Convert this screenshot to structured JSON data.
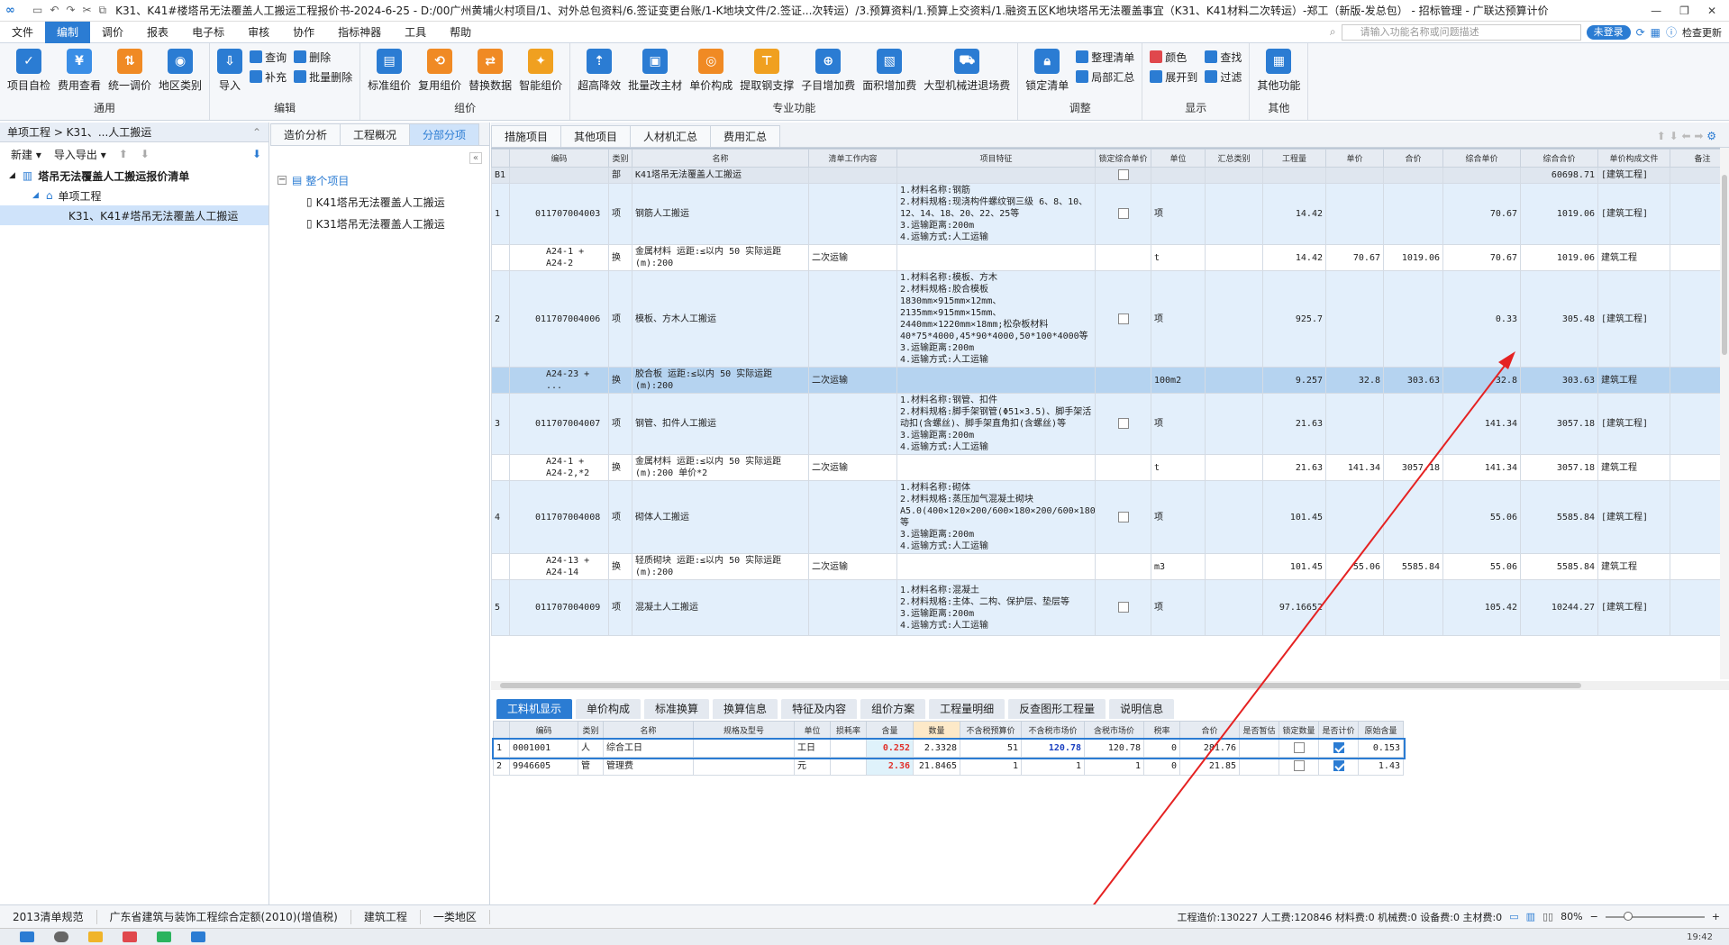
{
  "title": "K31、K41#楼塔吊无法覆盖人工搬运工程报价书-2024-6-25 - D:/00广州黄埔火村项目/1、对外总包资料/6.签证变更台账/1-K地块文件/2.签证...次转运）/3.预算资料/1.预算上交资料/1.融资五区K地块塔吊无法覆盖事宜（K31、K41材料二次转运）-郑工（新版-发总包） - 招标管理 - 广联达预算计价",
  "menu": [
    "文件",
    "编制",
    "调价",
    "报表",
    "电子标",
    "审核",
    "协作",
    "指标神器",
    "工具",
    "帮助"
  ],
  "menu_active": "编制",
  "search_placeholder": "请输入功能名称或问题描述",
  "login": "未登录",
  "check_update": "检查更新",
  "ribbon": {
    "g1": {
      "name": "通用",
      "b": [
        "项目自检",
        "费用查看",
        "统一调价",
        "地区类别"
      ]
    },
    "g2": {
      "name": "编辑",
      "b": [
        "导入",
        "查询",
        "补充",
        "删除",
        "批量删除"
      ]
    },
    "g3": {
      "name": "组价",
      "b": [
        "标准组价",
        "复用组价",
        "替换数据",
        "智能组价"
      ]
    },
    "g4": {
      "name": "专业功能",
      "b": [
        "超高降效",
        "批量改主材",
        "单价构成",
        "提取钢支撑",
        "子目增加费",
        "面积增加费",
        "大型机械进退场费"
      ]
    },
    "g5": {
      "name": "调整",
      "b": [
        "锁定清单",
        "整理清单",
        "局部汇总"
      ]
    },
    "g6": {
      "name": "显示",
      "b": [
        "颜色",
        "查找",
        "展开到",
        "过滤"
      ]
    },
    "g7": {
      "name": "其他",
      "b": [
        "其他功能"
      ]
    }
  },
  "left": {
    "breadcrumb": "单项工程 > K31、...人工搬运",
    "new": "新建",
    "import_export": "导入导出",
    "tree": [
      "塔吊无法覆盖人工搬运报价清单",
      "单项工程",
      "K31、K41#塔吊无法覆盖人工搬运"
    ]
  },
  "mid": {
    "tabs": [
      "造价分析",
      "工程概况",
      "分部分项"
    ],
    "tree": [
      "整个项目",
      "K41塔吊无法覆盖人工搬运",
      "K31塔吊无法覆盖人工搬运"
    ]
  },
  "main_tabs": [
    "措施项目",
    "其他项目",
    "人材机汇总",
    "费用汇总"
  ],
  "grid_headers": [
    "",
    "编码",
    "类别",
    "名称",
    "清单工作内容",
    "项目特征",
    "锁定综合单价",
    "单位",
    "汇总类别",
    "工程量",
    "单价",
    "合价",
    "综合单价",
    "综合合价",
    "单价构成文件",
    "备注"
  ],
  "rows": [
    {
      "t": "sec",
      "c": [
        "B1",
        "",
        "部",
        "K41塔吊无法覆盖人工搬运",
        "",
        "",
        "",
        "",
        "",
        "",
        "",
        "",
        "",
        "60698.71",
        "[建筑工程]",
        ""
      ]
    },
    {
      "t": "q",
      "c": [
        "1",
        "011707004003",
        "项",
        "钢筋人工搬运",
        "",
        "1.材料名称:钢筋\n2.材料规格:现浇构件螺纹钢三级 6、8、10、12、14、18、20、22、25等\n3.运输距离:200m\n4.运输方式:人工运输",
        "",
        "项",
        "",
        "14.42",
        "",
        "",
        "70.67",
        "1019.06",
        "[建筑工程]",
        ""
      ]
    },
    {
      "t": "d",
      "c": [
        "",
        "A24-1 + A24-2",
        "换",
        "金属材料 运距:≤以内 50 实际运距(m):200",
        "二次运输",
        "",
        "",
        "t",
        "",
        "14.42",
        "70.67",
        "1019.06",
        "70.67",
        "1019.06",
        "建筑工程",
        ""
      ]
    },
    {
      "t": "q",
      "c": [
        "2",
        "011707004006",
        "项",
        "模板、方木人工搬运",
        "",
        "1.材料名称:模板、方木\n2.材料规格:胶合模板 1830mm×915mm×12mm、2135mm×915mm×15mm、2440mm×1220mm×18mm;松杂板材料 40*75*4000,45*90*4000,50*100*4000等\n3.运输距离:200m\n4.运输方式:人工运输",
        "",
        "项",
        "",
        "925.7",
        "",
        "",
        "0.33",
        "305.48",
        "[建筑工程]",
        ""
      ]
    },
    {
      "t": "sel",
      "c": [
        "",
        "A24-23 + ...",
        "换",
        "胶合板 运距:≤以内 50 实际运距(m):200",
        "二次运输",
        "",
        "",
        "100m2",
        "",
        "9.257",
        "32.8",
        "303.63",
        "32.8",
        "303.63",
        "建筑工程",
        ""
      ]
    },
    {
      "t": "q",
      "c": [
        "3",
        "011707004007",
        "项",
        "钢管、扣件人工搬运",
        "",
        "1.材料名称:钢管、扣件\n2.材料规格:脚手架钢管(Φ51×3.5)、脚手架活动扣(含螺丝)、脚手架直角扣(含螺丝)等\n3.运输距离:200m\n4.运输方式:人工运输",
        "",
        "项",
        "",
        "21.63",
        "",
        "",
        "141.34",
        "3057.18",
        "[建筑工程]",
        ""
      ]
    },
    {
      "t": "d",
      "c": [
        "",
        "A24-1 + A24-2,*2",
        "换",
        "金属材料 运距:≤以内 50 实际运距(m):200 单价*2",
        "二次运输",
        "",
        "",
        "t",
        "",
        "21.63",
        "141.34",
        "3057.18",
        "141.34",
        "3057.18",
        "建筑工程",
        ""
      ]
    },
    {
      "t": "q",
      "c": [
        "4",
        "011707004008",
        "项",
        "砌体人工搬运",
        "",
        "1.材料名称:砌体\n2.材料规格:蒸压加气混凝土砌块A5.0(400×120×200/600×180×200/600×180×200)等\n3.运输距离:200m\n4.运输方式:人工运输",
        "",
        "项",
        "",
        "101.45",
        "",
        "",
        "55.06",
        "5585.84",
        "[建筑工程]",
        ""
      ]
    },
    {
      "t": "d",
      "c": [
        "",
        "A24-13 + A24-14",
        "换",
        "轻质砌块 运距:≤以内 50 实际运距(m):200",
        "二次运输",
        "",
        "",
        "m3",
        "",
        "101.45",
        "55.06",
        "5585.84",
        "55.06",
        "5585.84",
        "建筑工程",
        ""
      ]
    },
    {
      "t": "q",
      "c": [
        "5",
        "011707004009",
        "项",
        "混凝土人工搬运",
        "",
        "1.材料名称:混凝土\n2.材料规格:主体、二构、保护层、垫层等\n3.运输距离:200m\n4.运输方式:人工运输",
        "",
        "项",
        "",
        "97.16652",
        "",
        "",
        "105.42",
        "10244.27",
        "[建筑工程]",
        ""
      ]
    }
  ],
  "bottom_tabs": [
    "工料机显示",
    "单价构成",
    "标准换算",
    "换算信息",
    "特征及内容",
    "组价方案",
    "工程量明细",
    "反查图形工程量",
    "说明信息"
  ],
  "bottom_headers": [
    "",
    "编码",
    "类别",
    "名称",
    "规格及型号",
    "单位",
    "损耗率",
    "含量",
    "数量",
    "不含税预算价",
    "不含税市场价",
    "含税市场价",
    "税率",
    "合价",
    "是否暂估",
    "锁定数量",
    "是否计价",
    "原始含量"
  ],
  "bottom_rows": [
    {
      "c": [
        "1",
        "0001001",
        "人",
        "综合工日",
        "",
        "工日",
        "",
        "0.252",
        "2.3328",
        "51",
        "120.78",
        "120.78",
        "0",
        "281.76",
        "",
        "",
        "on",
        "0.153"
      ]
    },
    {
      "c": [
        "2",
        "9946605",
        "管",
        "管理费",
        "",
        "元",
        "",
        "2.36",
        "21.8465",
        "1",
        "1",
        "1",
        "0",
        "21.85",
        "",
        "",
        "on",
        "1.43"
      ]
    }
  ],
  "status": {
    "left": [
      "2013清单规范",
      "广东省建筑与装饰工程综合定额(2010)(增值税)",
      "建筑工程",
      "一类地区"
    ],
    "totals": "工程造价:130227  人工费:120846  材料费:0  机械费:0  设备费:0  主材费:0",
    "zoom": "80%"
  },
  "clock": "19:42"
}
